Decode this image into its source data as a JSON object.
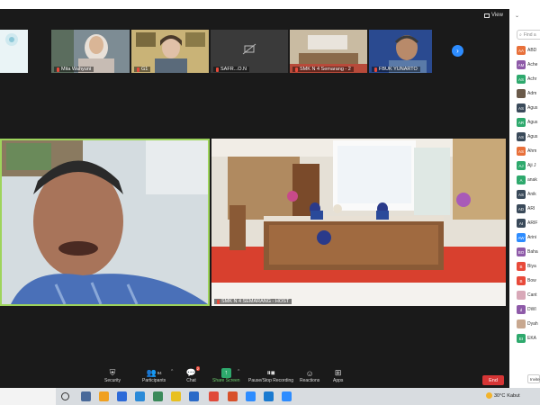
{
  "window": {
    "view_label": "View"
  },
  "strip": {
    "tiles": [
      {
        "label": ""
      },
      {
        "label": "Mita Wahyuni"
      },
      {
        "label": "G1"
      },
      {
        "label": "SAFR...O.N"
      },
      {
        "label": "SMK N 4 Semarang - 2"
      },
      {
        "label": "FBUK YUNARTO"
      }
    ]
  },
  "main": {
    "right_label": "SMK N 4 SEMARANG - HOST"
  },
  "toolbar": {
    "security": "Security",
    "participants": "Participants",
    "participants_count": "94",
    "chat": "Chat",
    "chat_badge": "2",
    "share": "Share Screen",
    "record": "Pause/Stop Recording",
    "reactions": "Reactions",
    "apps": "Apps",
    "end": "End"
  },
  "panel": {
    "search_placeholder": "Find a",
    "invite": "Invite",
    "participants": [
      {
        "initials": "AA",
        "name": "ABD",
        "color": "#e8703a"
      },
      {
        "initials": "AM",
        "name": "Ache",
        "color": "#8e5aa8"
      },
      {
        "initials": "AS",
        "name": "Achr",
        "color": "#2ea96d"
      },
      {
        "initials": "",
        "name": "Adm",
        "color": "#6a5a4a"
      },
      {
        "initials": "AS",
        "name": "Agus",
        "color": "#3a4a5a"
      },
      {
        "initials": "AR",
        "name": "Agus",
        "color": "#2ea96d"
      },
      {
        "initials": "AS",
        "name": "Agus",
        "color": "#3a4a5a"
      },
      {
        "initials": "AS",
        "name": "Ahm",
        "color": "#e8703a"
      },
      {
        "initials": "AJ",
        "name": "Aji J",
        "color": "#2ea96d"
      },
      {
        "initials": "A",
        "name": "anak",
        "color": "#2ea96d"
      },
      {
        "initials": "AS",
        "name": "Anik",
        "color": "#3a4a5a"
      },
      {
        "initials": "AD",
        "name": "ARI",
        "color": "#3a4a5a"
      },
      {
        "initials": "AI",
        "name": "ARIF",
        "color": "#3a4a5a"
      },
      {
        "initials": "AW",
        "name": "Arini",
        "color": "#2d8cff"
      },
      {
        "initials": "BO",
        "name": "Baha",
        "color": "#8e5aa8"
      },
      {
        "initials": "B",
        "name": "Biya",
        "color": "#e84a3a"
      },
      {
        "initials": "B",
        "name": "Bow",
        "color": "#e84a3a"
      },
      {
        "initials": "",
        "name": "Cant",
        "color": "#d8a8b8"
      },
      {
        "initials": "d",
        "name": "DWI",
        "color": "#8e5aa8"
      },
      {
        "initials": "",
        "name": "Dyah",
        "color": "#c8a890"
      },
      {
        "initials": "EI",
        "name": "EKA",
        "color": "#2ea96d"
      }
    ]
  },
  "taskbar": {
    "temp": "30°C",
    "weather": "Kabut"
  },
  "colors": {
    "accent": "#2d8cff",
    "active_speaker_border": "#9ed45c",
    "end": "#d63535"
  }
}
